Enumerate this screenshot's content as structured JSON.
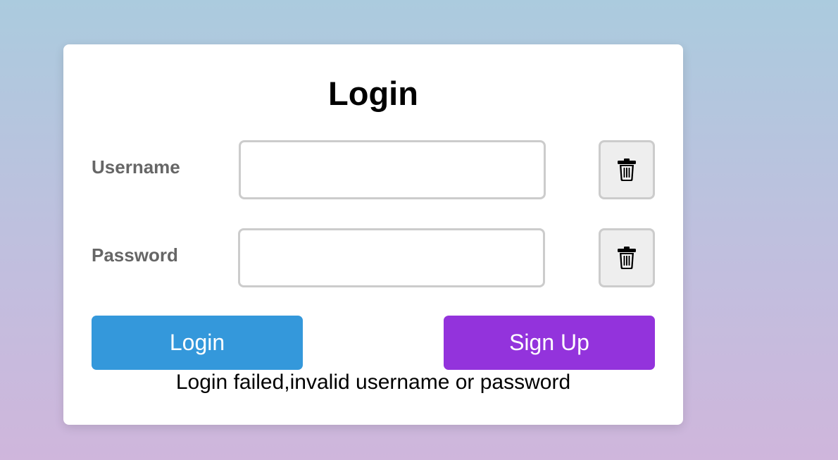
{
  "login_form": {
    "title": "Login",
    "username": {
      "label": "Username",
      "value": "",
      "placeholder": "",
      "clear_icon": "trash-icon"
    },
    "password": {
      "label": "Password",
      "value": "",
      "placeholder": "",
      "clear_icon": "trash-icon"
    },
    "login_button_label": "Login",
    "signup_button_label": "Sign Up",
    "status_message": "Login failed,invalid username or password"
  },
  "colors": {
    "login_button": "#3498db",
    "signup_button": "#9333dc",
    "label_text": "#666666",
    "card_background": "#ffffff"
  }
}
